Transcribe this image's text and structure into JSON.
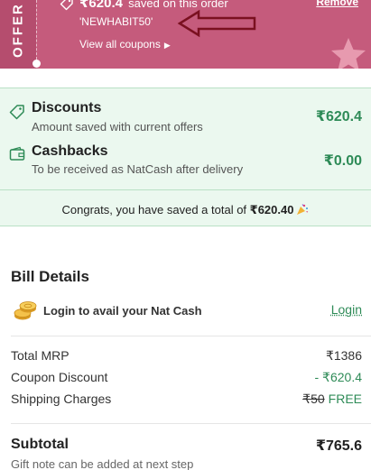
{
  "offer": {
    "tab_label": "OFFER",
    "saved_amount": "₹620.4",
    "saved_text": "saved on this order",
    "coupon_code": "'NEWHABIT50'",
    "view_all": "View all coupons",
    "remove": "Remove",
    "banner_color": "#c55b7c"
  },
  "savings": {
    "discounts": {
      "title": "Discounts",
      "subtitle": "Amount saved with current offers",
      "value": "₹620.4",
      "icon": "tag-icon"
    },
    "cashbacks": {
      "title": "Cashbacks",
      "subtitle": "To be received as NatCash after delivery",
      "value": "₹0.00",
      "icon": "wallet-icon"
    },
    "congrats_prefix": "Congrats, you have saved a total of ",
    "congrats_amount": "₹620.40",
    "accent_color": "#2e8b57"
  },
  "bill": {
    "title": "Bill Details",
    "natcash_prompt": "Login to avail your Nat Cash",
    "login": "Login",
    "rows": [
      {
        "label": "Total MRP",
        "value": "₹1386"
      },
      {
        "label": "Coupon Discount",
        "value": "- ₹620.4"
      },
      {
        "label": "Shipping Charges",
        "strike": "₹50",
        "value": "FREE"
      }
    ],
    "subtotal_label": "Subtotal",
    "subtotal_value": "₹765.6",
    "gift_note": "Gift note can be added at next step"
  }
}
